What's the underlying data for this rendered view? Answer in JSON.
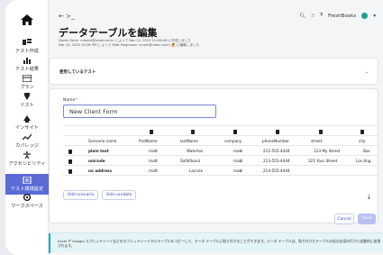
{
  "sidebar": {
    "items": [
      {
        "label": "テスト作成",
        "icon": "test-create-icon"
      },
      {
        "label": "テスト結果",
        "icon": "test-results-icon"
      },
      {
        "label": "プラン",
        "icon": "plan-icon"
      },
      {
        "label": "ドスト",
        "icon": "test-icon"
      },
      {
        "label": "インサイト",
        "icon": "insight-icon"
      },
      {
        "label": "カバレッジ",
        "icon": "coverage-icon"
      },
      {
        "label": "アクセシビリティ",
        "icon": "accessibility-icon"
      },
      {
        "label": "テスト環境設定",
        "icon": "settings-icon"
      },
      {
        "label": "ワークスペース",
        "icon": "workspace-icon"
      }
    ]
  },
  "topbar": {
    "back_label": "← ≻_",
    "org_label": "FreshBooks"
  },
  "page": {
    "title": "データテーブルを編集",
    "meta_line1": "Daniel Farris <daniel@mabl.com> によって Nov 22, 2019 11:08 AM に作成しました",
    "meta_line2": "Mar 24, 2020 10:26 PM に よって Matt Magnuson <matt@mabl.com> 🙋 に編集しました"
  },
  "usage_section": {
    "label": "使用しているテスト"
  },
  "form": {
    "name_label": "Name",
    "name_required": "*",
    "name_value": "New Client Form",
    "columns": [
      "Scenario name",
      "firstName",
      "lastName",
      "company",
      "phoneNumber",
      "street",
      "city"
    ],
    "rows": [
      [
        "plain text",
        "matt",
        "Waterlos",
        "mabl",
        "212-555-4444",
        "123 My Street",
        "Bos"
      ],
      [
        "unicode",
        "matt",
        "Šafáříková",
        "mabl",
        "213-555-4444",
        "321 Your Street",
        "Los Ang"
      ],
      [
        "no address",
        "matt",
        "Lacroix",
        "mabl",
        "214-555-4444",
        "",
        ""
      ]
    ],
    "add_scenario_label": "Add scenario",
    "add_variable_label": "Add variable",
    "cancel_label": "Cancel",
    "save_label": "Save"
  },
  "banner": {
    "text": "Excel や Google スプレッドシートなどのスプレッドシートからテーブルをコピーして、データ テーブルに貼り付けることができます。データ テーブルは、貼り付けたテーブルの自分自身の行から自動的に拡張されます。"
  },
  "colors": {
    "accent": "#5b6bd6",
    "org_dot": "#1aa38a",
    "banner_bar": "#2aa7b5"
  }
}
